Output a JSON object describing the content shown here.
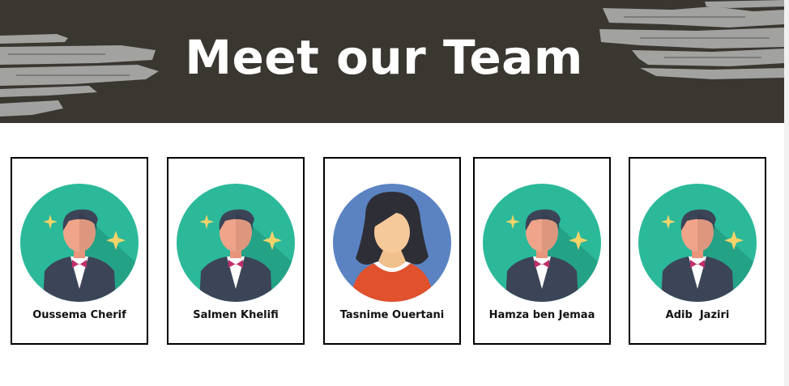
{
  "hero": {
    "title": "Meet our Team",
    "background_color": "#3a3630",
    "brush_color": "#a8a8a8"
  },
  "team": {
    "members": [
      {
        "name": "Oussema Cherif",
        "avatar": "man-avatar-icon"
      },
      {
        "name": "Salmen Khelifi",
        "avatar": "man-avatar-icon"
      },
      {
        "name": "Tasnime Ouertani",
        "avatar": "woman-avatar-icon"
      },
      {
        "name": "Hamza ben Jemaa",
        "avatar": "man-avatar-icon"
      },
      {
        "name": "Adib  Jaziri",
        "avatar": "man-avatar-icon"
      }
    ]
  },
  "colors": {
    "man_avatar_bg": "#2bb99a",
    "woman_avatar_bg": "#5b83c2",
    "suit": "#3c4458",
    "skin": "#f0a48a",
    "tie": "#c0306a",
    "sparkle": "#f5d36a",
    "woman_top": "#e0512c"
  }
}
